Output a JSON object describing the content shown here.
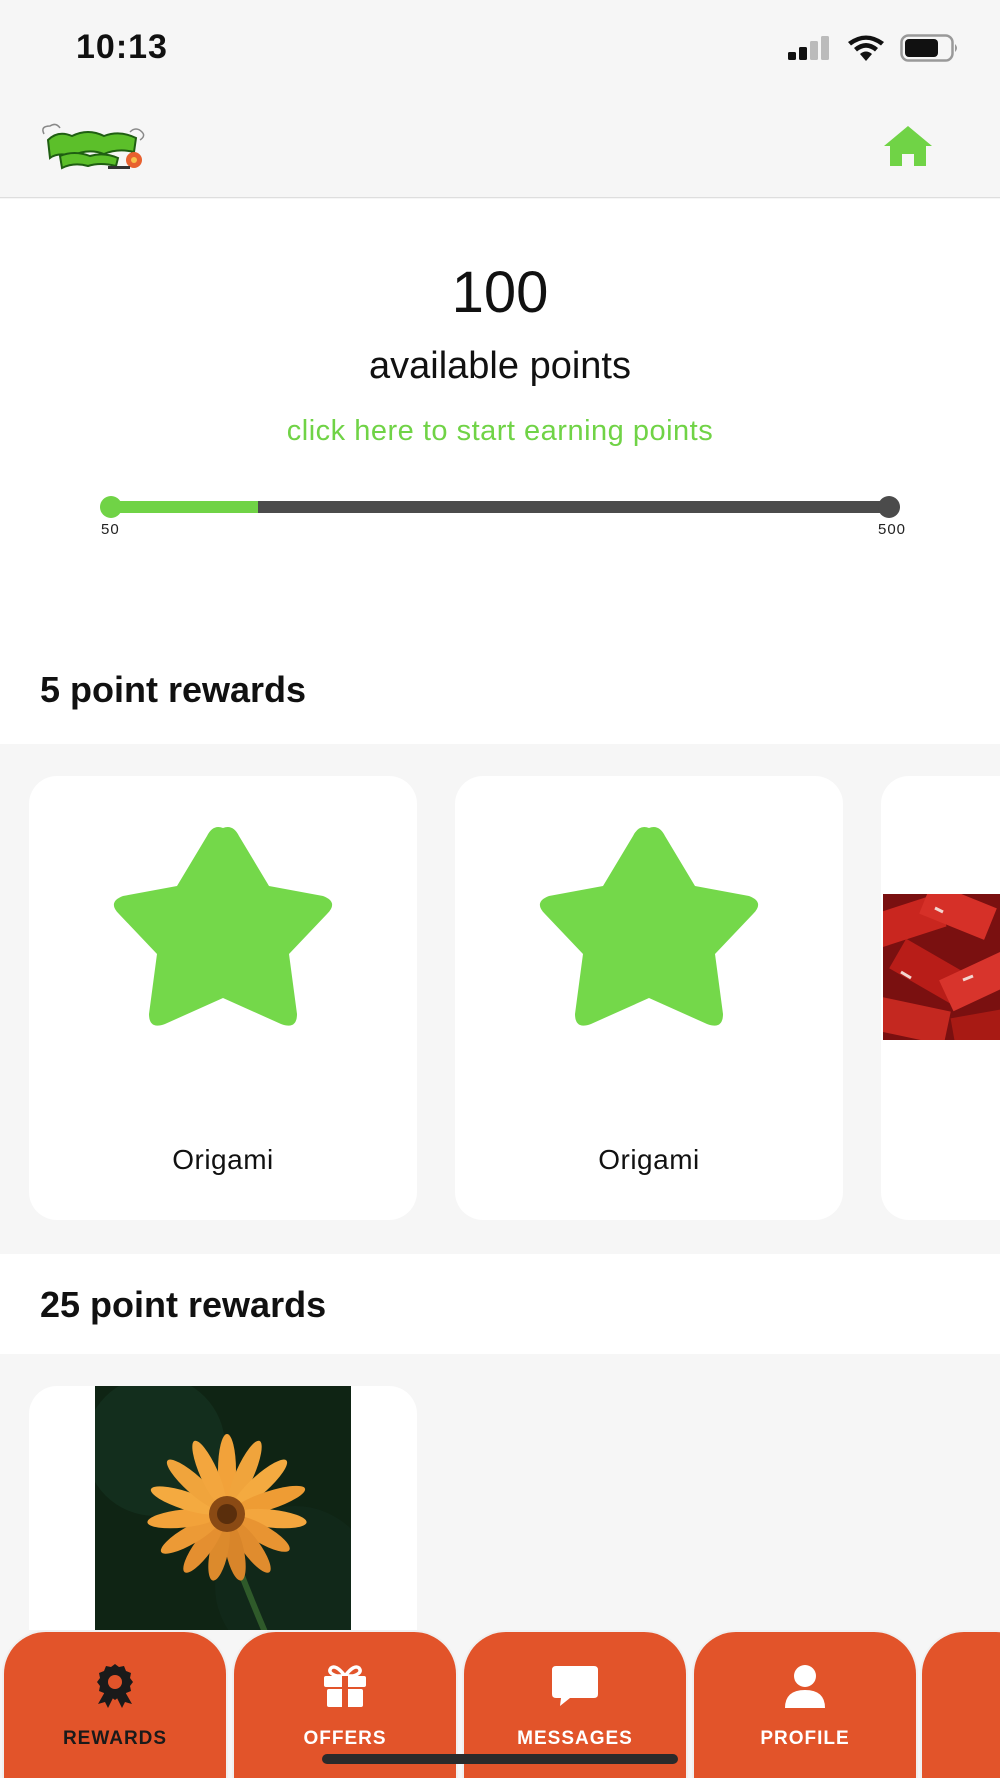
{
  "status_bar": {
    "time": "10:13"
  },
  "header": {
    "logo_alt": "Flower Power logo",
    "home_icon": "home-icon"
  },
  "points": {
    "value": "100",
    "label": "available points",
    "earn_link": "click here to start earning points",
    "progress": {
      "min_label": "50",
      "max_label": "500",
      "fill_fraction": 0.19
    }
  },
  "sections": [
    {
      "title": "5 point rewards",
      "cards": [
        {
          "label": "Origami",
          "icon": "star-icon"
        },
        {
          "label": "Origami",
          "icon": "star-icon"
        },
        {
          "label": "",
          "image": "red-tags-photo"
        }
      ]
    },
    {
      "title": "25 point rewards",
      "cards": [
        {
          "label": "",
          "image": "orange-flower-photo"
        }
      ]
    }
  ],
  "tabs": [
    {
      "label": "REWARDS",
      "icon": "award-icon",
      "active": true
    },
    {
      "label": "OFFERS",
      "icon": "gift-icon",
      "active": false
    },
    {
      "label": "MESSAGES",
      "icon": "chat-bubble-icon",
      "active": false
    },
    {
      "label": "PROFILE",
      "icon": "person-icon",
      "active": false
    }
  ],
  "colors": {
    "accent_green": "#70d346",
    "tab_orange": "#e2542a",
    "track_dark": "#4b4b4b"
  }
}
